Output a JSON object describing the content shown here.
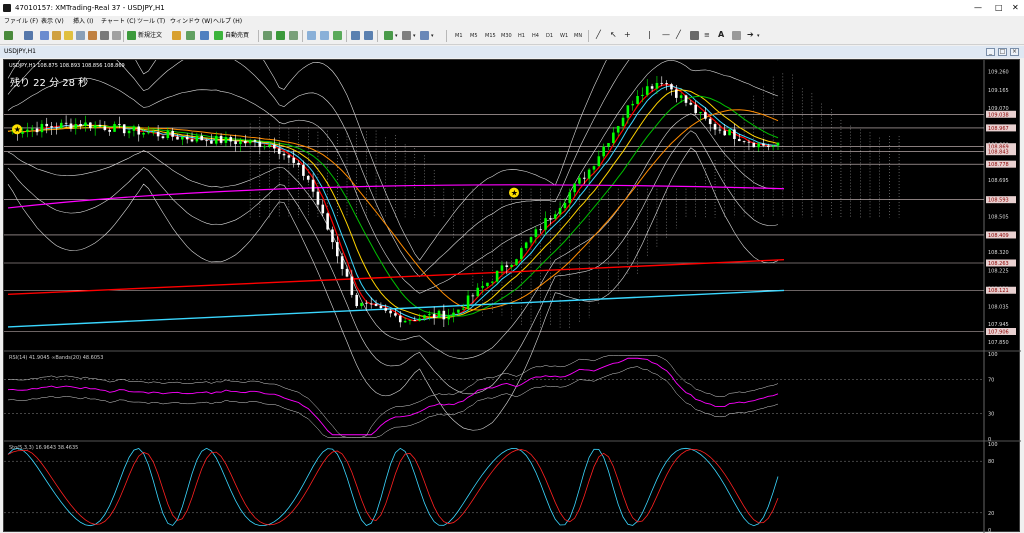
{
  "window": {
    "title": "47010157: XMTrading-Real 37 - USDJPY,H1"
  },
  "menu": [
    {
      "label": "ファイル (F)"
    },
    {
      "label": "表示 (V)"
    },
    {
      "label": "挿入 (I)"
    },
    {
      "label": "チャート (C)"
    },
    {
      "label": "ツール (T)"
    },
    {
      "label": "ウィンドウ (W)"
    },
    {
      "label": "ヘルプ (H)"
    }
  ],
  "toolbar": {
    "new_order": "新規注文",
    "auto_trade": "自動売買",
    "timeframes": [
      "M1",
      "M5",
      "M15",
      "M30",
      "H1",
      "H4",
      "D1",
      "W1",
      "MN"
    ]
  },
  "chart": {
    "tab_label": "USDJPY,H1",
    "symbol_ohlc": "USDJPY,H1  108.875 108.893 108.856 108.869",
    "countdown": "残り 22 分 28 秒",
    "rsi_label": "RSI(14) 41.9045   ∞Bands(20) 48.6053",
    "stoch_label": "Sto(5,3,3) 16.9643 38.4635"
  },
  "price_axis": {
    "ticks": [
      "109.260",
      "109.165",
      "109.070",
      "108.975",
      "108.880",
      "108.785",
      "108.695",
      "108.600",
      "108.505",
      "108.410",
      "108.320",
      "108.225",
      "108.130",
      "108.035",
      "107.945",
      "107.850"
    ],
    "line_labels": [
      "109.038",
      "108.967",
      "108.869",
      "108.843",
      "108.778",
      "108.593",
      "108.409",
      "108.263",
      "108.121",
      "107.906"
    ]
  },
  "rsi_axis": {
    "ticks": [
      "100",
      "70",
      "30",
      "0"
    ]
  },
  "stoch_axis": {
    "ticks": [
      "100",
      "80",
      "20",
      "0"
    ]
  },
  "colors": {
    "bull": "#00ff00",
    "bear": "#ffffff",
    "ma_red": "#ff0000",
    "ma_cyan": "#3ad7ff",
    "ma_magenta": "#ff00ff",
    "ma_orange": "#ff8c00",
    "ma_yellow": "#ffd400",
    "ma_green": "#00c000",
    "accent_toolbar": "#f0f0f0"
  }
}
